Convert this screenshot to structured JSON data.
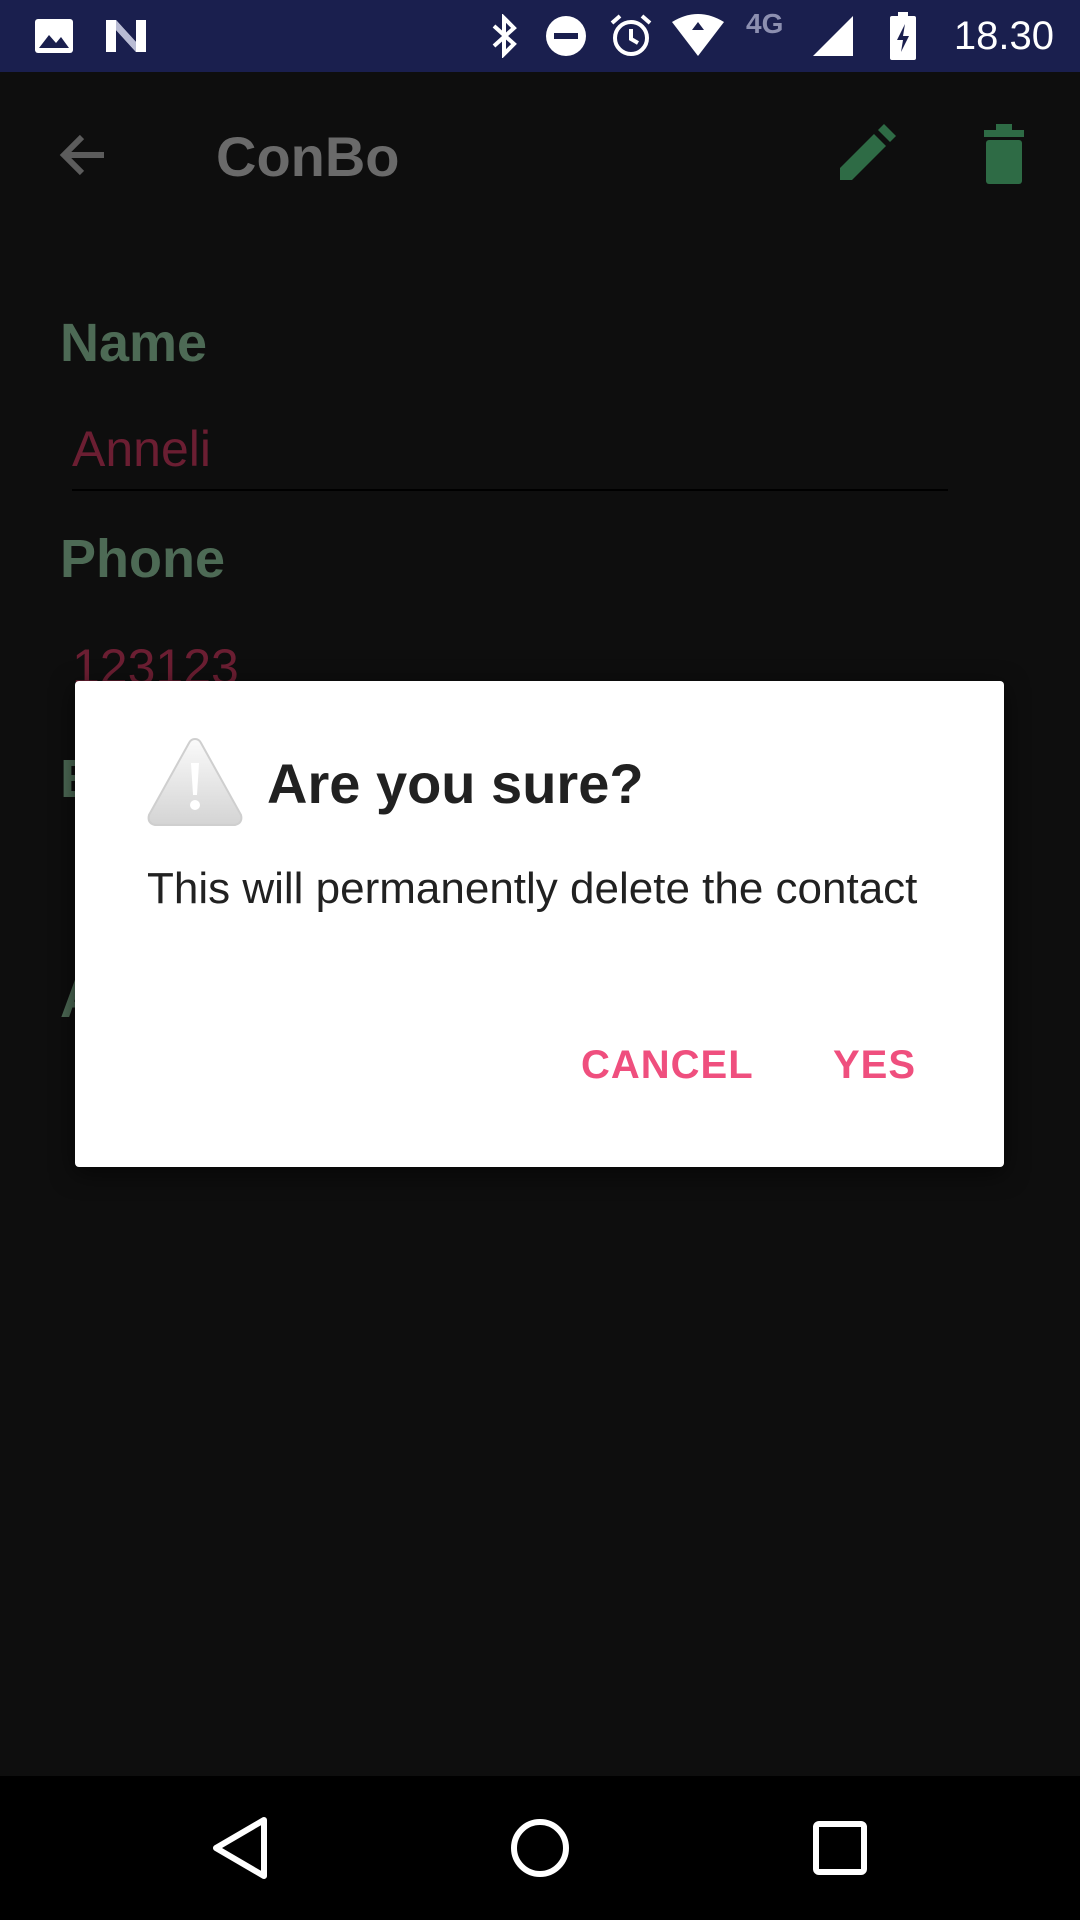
{
  "status_bar": {
    "time": "18.30",
    "network_label": "4G",
    "icons": [
      "image-icon",
      "n-icon",
      "bluetooth-icon",
      "dnd-icon",
      "alarm-icon",
      "wifi-icon",
      "signal-icon",
      "battery-icon"
    ]
  },
  "app_bar": {
    "title": "ConBo",
    "back_icon": "arrow-back-icon",
    "edit_icon": "pencil-icon",
    "delete_icon": "trash-icon",
    "accent_color": "#2e6b45"
  },
  "form": {
    "name_label": "Name",
    "name_value": "Anneli",
    "phone_label": "Phone",
    "phone_value": "123123",
    "email_label_partial": "E",
    "address_label_partial": "A"
  },
  "dialog": {
    "icon": "warning-icon",
    "title": "Are you sure?",
    "message": "This will permanently delete the contact",
    "cancel_label": "CANCEL",
    "yes_label": "YES",
    "button_color": "#ef4f7e"
  },
  "nav_bar": {
    "icons": [
      "back-triangle-icon",
      "home-circle-icon",
      "recents-square-icon"
    ]
  }
}
